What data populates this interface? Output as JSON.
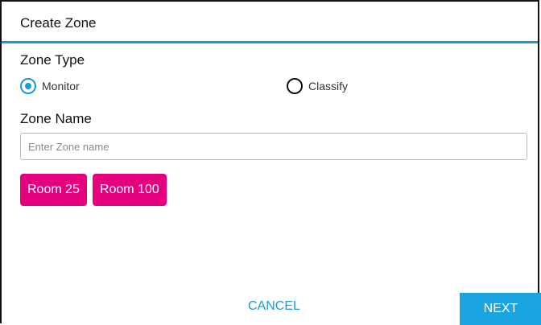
{
  "dialog": {
    "title": "Create Zone"
  },
  "zone_type": {
    "label": "Zone Type",
    "options": [
      {
        "label": "Monitor",
        "selected": true
      },
      {
        "label": "Classify",
        "selected": false
      }
    ]
  },
  "zone_name": {
    "label": "Zone Name",
    "value": "",
    "placeholder": "Enter Zone name"
  },
  "rooms": [
    {
      "label": "Room 25"
    },
    {
      "label": "Room 100"
    }
  ],
  "actions": {
    "cancel_label": "CANCEL",
    "next_label": "NEXT"
  },
  "colors": {
    "accent": "#1a9ad6",
    "next_button": "#1aa5e0",
    "chip": "#e5007e",
    "header_rule": "#1a9ad6"
  },
  "icons": {
    "radio_selected": "radio-selected-icon",
    "radio_unselected": "radio-unselected-icon"
  }
}
